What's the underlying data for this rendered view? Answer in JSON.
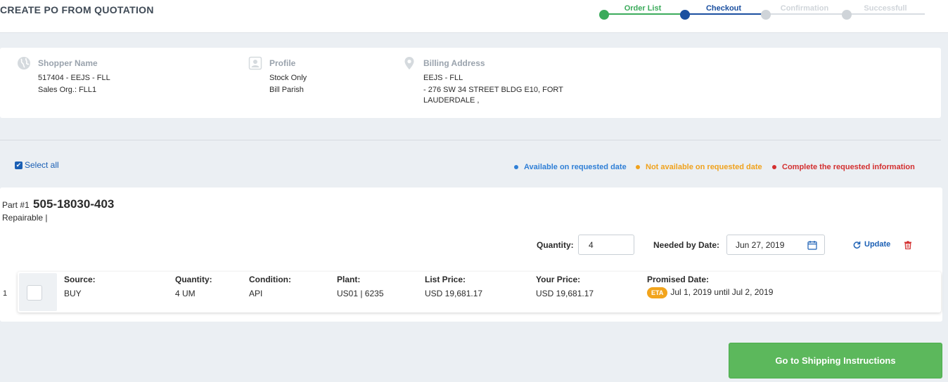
{
  "page": {
    "title": "CREATE PO FROM QUOTATION"
  },
  "stepper": {
    "steps": [
      {
        "label": "Order List",
        "state": "done",
        "color": "#3bab5b"
      },
      {
        "label": "Checkout",
        "state": "active",
        "color": "#1a4fa0"
      },
      {
        "label": "Confirmation",
        "state": "pending",
        "color": "#cfd4d9"
      },
      {
        "label": "Successfull",
        "state": "pending",
        "color": "#cfd4d9"
      }
    ]
  },
  "info": {
    "shopper": {
      "heading": "Shopper Name",
      "line1": "517404 - EEJS - FLL",
      "line2": "Sales Org.: FLL1",
      "icon": "globe-icon"
    },
    "profile": {
      "heading": "Profile",
      "line1": "Stock Only",
      "line2": "Bill Parish",
      "icon": "profile-card-icon"
    },
    "billing": {
      "heading": "Billing Address",
      "line1": "EEJS - FLL",
      "line2": "- 276 SW 34 STREET BLDG E10, FORT",
      "line3": "LAUDERDALE ,",
      "icon": "map-pin-icon"
    }
  },
  "select_all": {
    "label": "Select all",
    "checked": true
  },
  "legend": {
    "available": {
      "label": "Available on requested date",
      "color": "#2f7fd6"
    },
    "not_available": {
      "label": "Not available on requested date",
      "color": "#f0a21c"
    },
    "complete_info": {
      "label": "Complete the requested information",
      "color": "#d32f2f"
    }
  },
  "part": {
    "prefix": "Part #1",
    "number": "505-18030-403",
    "subtitle": "Repairable |",
    "quantity_label": "Quantity:",
    "quantity_value": "4",
    "needed_date_label": "Needed by Date:",
    "needed_date_value": "Jun 27, 2019",
    "update_label": "Update"
  },
  "line_item": {
    "index": "1",
    "source_label": "Source:",
    "source_value": "BUY",
    "quantity_label": "Quantity:",
    "quantity_value": "4 UM",
    "condition_label": "Condition:",
    "condition_value": "API",
    "plant_label": "Plant:",
    "plant_value": "US01 | 6235",
    "list_price_label": "List Price:",
    "list_price_value": "USD 19,681.17",
    "your_price_label": "Your Price:",
    "your_price_value": "USD 19,681.17",
    "promised_label": "Promised Date:",
    "eta_badge": "ETA",
    "promised_value": "Jul 1, 2019 until Jul 2, 2019"
  },
  "actions": {
    "go_shipping_label": "Go to Shipping Instructions"
  }
}
